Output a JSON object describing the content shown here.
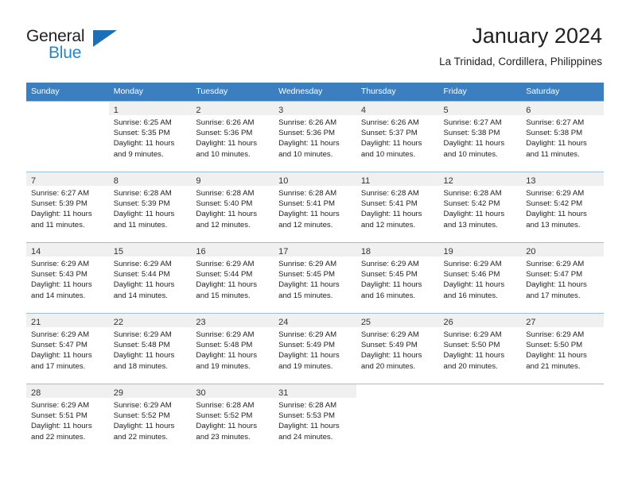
{
  "brand": {
    "name_part1": "General",
    "name_part2": "Blue",
    "triangle_color": "#1c6fb5",
    "blue_color": "#2585d3"
  },
  "header": {
    "title": "January 2024",
    "subtitle": "La Trinidad, Cordillera, Philippines"
  },
  "colors": {
    "header_row_bg": "#3c7fc1",
    "header_row_text": "#ffffff",
    "daynum_bg": "#f0f0f0",
    "row_divider": "#9fbcd8"
  },
  "weekdays": [
    "Sunday",
    "Monday",
    "Tuesday",
    "Wednesday",
    "Thursday",
    "Friday",
    "Saturday"
  ],
  "weeks": [
    [
      {
        "day": "",
        "sunrise": "",
        "sunset": "",
        "daylight1": "",
        "daylight2": "",
        "empty": true
      },
      {
        "day": "1",
        "sunrise": "Sunrise: 6:25 AM",
        "sunset": "Sunset: 5:35 PM",
        "daylight1": "Daylight: 11 hours",
        "daylight2": "and 9 minutes.",
        "empty": false
      },
      {
        "day": "2",
        "sunrise": "Sunrise: 6:26 AM",
        "sunset": "Sunset: 5:36 PM",
        "daylight1": "Daylight: 11 hours",
        "daylight2": "and 10 minutes.",
        "empty": false
      },
      {
        "day": "3",
        "sunrise": "Sunrise: 6:26 AM",
        "sunset": "Sunset: 5:36 PM",
        "daylight1": "Daylight: 11 hours",
        "daylight2": "and 10 minutes.",
        "empty": false
      },
      {
        "day": "4",
        "sunrise": "Sunrise: 6:26 AM",
        "sunset": "Sunset: 5:37 PM",
        "daylight1": "Daylight: 11 hours",
        "daylight2": "and 10 minutes.",
        "empty": false
      },
      {
        "day": "5",
        "sunrise": "Sunrise: 6:27 AM",
        "sunset": "Sunset: 5:38 PM",
        "daylight1": "Daylight: 11 hours",
        "daylight2": "and 10 minutes.",
        "empty": false
      },
      {
        "day": "6",
        "sunrise": "Sunrise: 6:27 AM",
        "sunset": "Sunset: 5:38 PM",
        "daylight1": "Daylight: 11 hours",
        "daylight2": "and 11 minutes.",
        "empty": false
      }
    ],
    [
      {
        "day": "7",
        "sunrise": "Sunrise: 6:27 AM",
        "sunset": "Sunset: 5:39 PM",
        "daylight1": "Daylight: 11 hours",
        "daylight2": "and 11 minutes.",
        "empty": false
      },
      {
        "day": "8",
        "sunrise": "Sunrise: 6:28 AM",
        "sunset": "Sunset: 5:39 PM",
        "daylight1": "Daylight: 11 hours",
        "daylight2": "and 11 minutes.",
        "empty": false
      },
      {
        "day": "9",
        "sunrise": "Sunrise: 6:28 AM",
        "sunset": "Sunset: 5:40 PM",
        "daylight1": "Daylight: 11 hours",
        "daylight2": "and 12 minutes.",
        "empty": false
      },
      {
        "day": "10",
        "sunrise": "Sunrise: 6:28 AM",
        "sunset": "Sunset: 5:41 PM",
        "daylight1": "Daylight: 11 hours",
        "daylight2": "and 12 minutes.",
        "empty": false
      },
      {
        "day": "11",
        "sunrise": "Sunrise: 6:28 AM",
        "sunset": "Sunset: 5:41 PM",
        "daylight1": "Daylight: 11 hours",
        "daylight2": "and 12 minutes.",
        "empty": false
      },
      {
        "day": "12",
        "sunrise": "Sunrise: 6:28 AM",
        "sunset": "Sunset: 5:42 PM",
        "daylight1": "Daylight: 11 hours",
        "daylight2": "and 13 minutes.",
        "empty": false
      },
      {
        "day": "13",
        "sunrise": "Sunrise: 6:29 AM",
        "sunset": "Sunset: 5:42 PM",
        "daylight1": "Daylight: 11 hours",
        "daylight2": "and 13 minutes.",
        "empty": false
      }
    ],
    [
      {
        "day": "14",
        "sunrise": "Sunrise: 6:29 AM",
        "sunset": "Sunset: 5:43 PM",
        "daylight1": "Daylight: 11 hours",
        "daylight2": "and 14 minutes.",
        "empty": false
      },
      {
        "day": "15",
        "sunrise": "Sunrise: 6:29 AM",
        "sunset": "Sunset: 5:44 PM",
        "daylight1": "Daylight: 11 hours",
        "daylight2": "and 14 minutes.",
        "empty": false
      },
      {
        "day": "16",
        "sunrise": "Sunrise: 6:29 AM",
        "sunset": "Sunset: 5:44 PM",
        "daylight1": "Daylight: 11 hours",
        "daylight2": "and 15 minutes.",
        "empty": false
      },
      {
        "day": "17",
        "sunrise": "Sunrise: 6:29 AM",
        "sunset": "Sunset: 5:45 PM",
        "daylight1": "Daylight: 11 hours",
        "daylight2": "and 15 minutes.",
        "empty": false
      },
      {
        "day": "18",
        "sunrise": "Sunrise: 6:29 AM",
        "sunset": "Sunset: 5:45 PM",
        "daylight1": "Daylight: 11 hours",
        "daylight2": "and 16 minutes.",
        "empty": false
      },
      {
        "day": "19",
        "sunrise": "Sunrise: 6:29 AM",
        "sunset": "Sunset: 5:46 PM",
        "daylight1": "Daylight: 11 hours",
        "daylight2": "and 16 minutes.",
        "empty": false
      },
      {
        "day": "20",
        "sunrise": "Sunrise: 6:29 AM",
        "sunset": "Sunset: 5:47 PM",
        "daylight1": "Daylight: 11 hours",
        "daylight2": "and 17 minutes.",
        "empty": false
      }
    ],
    [
      {
        "day": "21",
        "sunrise": "Sunrise: 6:29 AM",
        "sunset": "Sunset: 5:47 PM",
        "daylight1": "Daylight: 11 hours",
        "daylight2": "and 17 minutes.",
        "empty": false
      },
      {
        "day": "22",
        "sunrise": "Sunrise: 6:29 AM",
        "sunset": "Sunset: 5:48 PM",
        "daylight1": "Daylight: 11 hours",
        "daylight2": "and 18 minutes.",
        "empty": false
      },
      {
        "day": "23",
        "sunrise": "Sunrise: 6:29 AM",
        "sunset": "Sunset: 5:48 PM",
        "daylight1": "Daylight: 11 hours",
        "daylight2": "and 19 minutes.",
        "empty": false
      },
      {
        "day": "24",
        "sunrise": "Sunrise: 6:29 AM",
        "sunset": "Sunset: 5:49 PM",
        "daylight1": "Daylight: 11 hours",
        "daylight2": "and 19 minutes.",
        "empty": false
      },
      {
        "day": "25",
        "sunrise": "Sunrise: 6:29 AM",
        "sunset": "Sunset: 5:49 PM",
        "daylight1": "Daylight: 11 hours",
        "daylight2": "and 20 minutes.",
        "empty": false
      },
      {
        "day": "26",
        "sunrise": "Sunrise: 6:29 AM",
        "sunset": "Sunset: 5:50 PM",
        "daylight1": "Daylight: 11 hours",
        "daylight2": "and 20 minutes.",
        "empty": false
      },
      {
        "day": "27",
        "sunrise": "Sunrise: 6:29 AM",
        "sunset": "Sunset: 5:50 PM",
        "daylight1": "Daylight: 11 hours",
        "daylight2": "and 21 minutes.",
        "empty": false
      }
    ],
    [
      {
        "day": "28",
        "sunrise": "Sunrise: 6:29 AM",
        "sunset": "Sunset: 5:51 PM",
        "daylight1": "Daylight: 11 hours",
        "daylight2": "and 22 minutes.",
        "empty": false
      },
      {
        "day": "29",
        "sunrise": "Sunrise: 6:29 AM",
        "sunset": "Sunset: 5:52 PM",
        "daylight1": "Daylight: 11 hours",
        "daylight2": "and 22 minutes.",
        "empty": false
      },
      {
        "day": "30",
        "sunrise": "Sunrise: 6:28 AM",
        "sunset": "Sunset: 5:52 PM",
        "daylight1": "Daylight: 11 hours",
        "daylight2": "and 23 minutes.",
        "empty": false
      },
      {
        "day": "31",
        "sunrise": "Sunrise: 6:28 AM",
        "sunset": "Sunset: 5:53 PM",
        "daylight1": "Daylight: 11 hours",
        "daylight2": "and 24 minutes.",
        "empty": false
      },
      {
        "day": "",
        "sunrise": "",
        "sunset": "",
        "daylight1": "",
        "daylight2": "",
        "empty": true
      },
      {
        "day": "",
        "sunrise": "",
        "sunset": "",
        "daylight1": "",
        "daylight2": "",
        "empty": true
      },
      {
        "day": "",
        "sunrise": "",
        "sunset": "",
        "daylight1": "",
        "daylight2": "",
        "empty": true
      }
    ]
  ]
}
